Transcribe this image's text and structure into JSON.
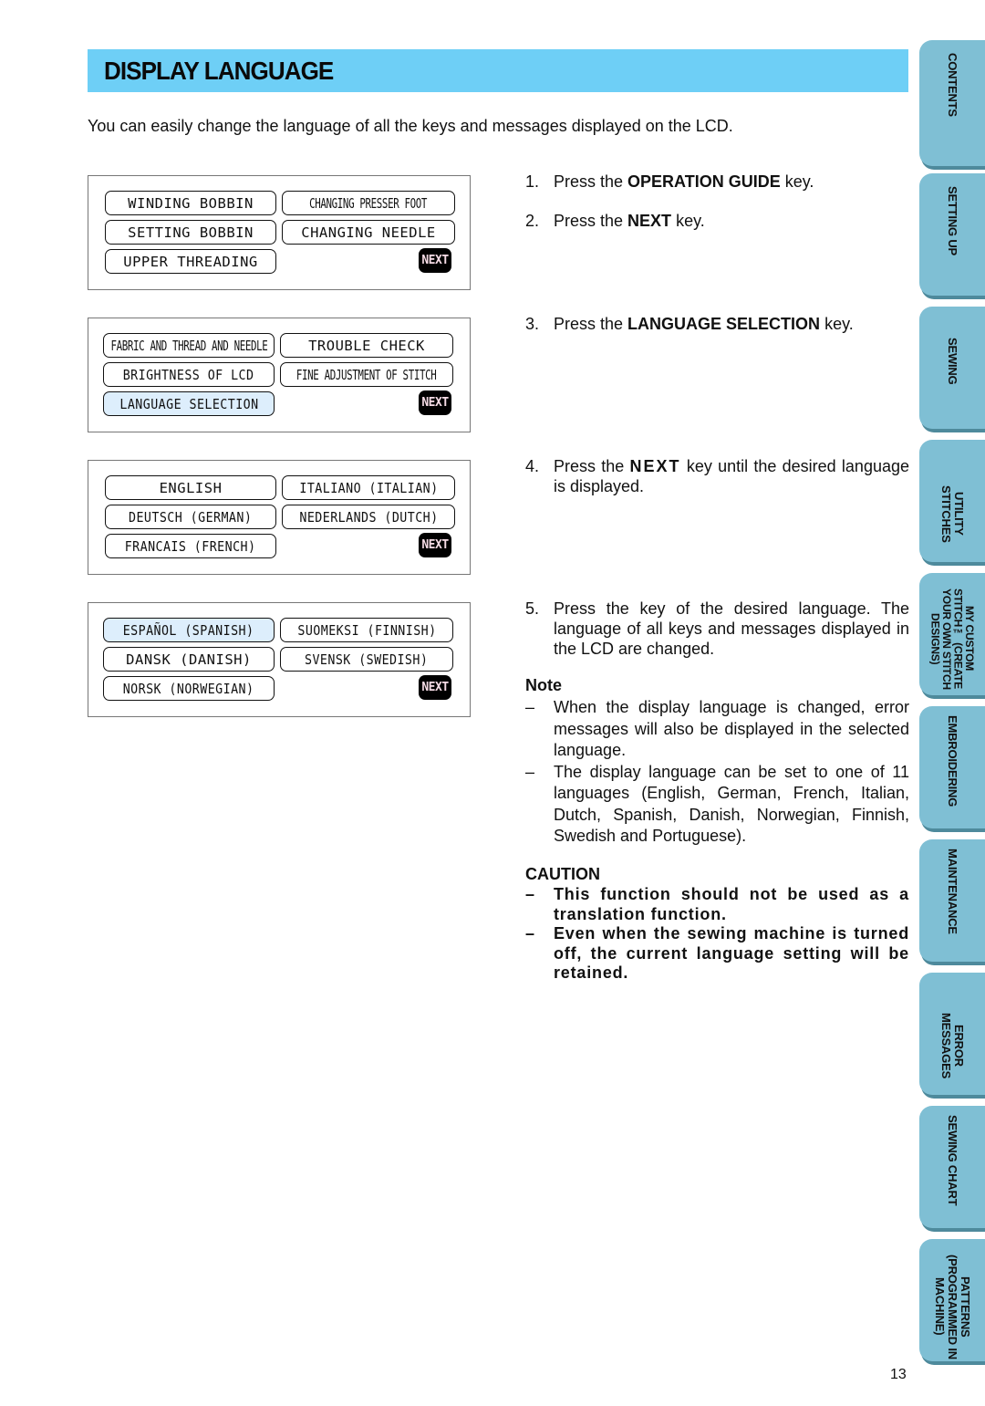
{
  "header": {
    "title": "DISPLAY LANGUAGE",
    "accent_color": "#6ecff6"
  },
  "intro": "You can easily change the language of all the keys and messages displayed on the LCD.",
  "lcd_screens": [
    {
      "keys": [
        "WINDING BOBBIN",
        "CHANGING PRESSER FOOT",
        "SETTING BOBBIN",
        "CHANGING NEEDLE",
        "UPPER THREADING"
      ],
      "next": "NEXT"
    },
    {
      "keys": [
        "FABRIC AND THREAD AND NEEDLE",
        "TROUBLE CHECK",
        "BRIGHTNESS OF LCD",
        "FINE ADJUSTMENT OF STITCH",
        "LANGUAGE SELECTION"
      ],
      "selected": "LANGUAGE SELECTION",
      "next": "NEXT"
    },
    {
      "keys": [
        "ENGLISH",
        "ITALIANO (ITALIAN)",
        "DEUTSCH (GERMAN)",
        "NEDERLANDS (DUTCH)",
        "FRANCAIS (FRENCH)"
      ],
      "next": "NEXT"
    },
    {
      "keys": [
        "ESPAÑOL (SPANISH)",
        "SUOMEKSI (FINNISH)",
        "DANSK (DANISH)",
        "SVENSK (SWEDISH)",
        "NORSK (NORWEGIAN)"
      ],
      "selected": "ESPAÑOL (SPANISH)",
      "next": "NEXT"
    }
  ],
  "steps": [
    {
      "num": "1.",
      "pre": "Press the ",
      "bold": "OPERATION GUIDE",
      "post": " key."
    },
    {
      "num": "2.",
      "pre": "Press the ",
      "bold": "NEXT",
      "post": " key."
    },
    {
      "num": "3.",
      "pre": "Press the ",
      "bold": "LANGUAGE SELECTION",
      "post": " key."
    },
    {
      "num": "4.",
      "pre": "Press the ",
      "bold": "NEXT",
      "post": " key until the desired language is displayed."
    },
    {
      "num": "5.",
      "pre": "Press the key of the desired language. The language of all keys and messages displayed in the LCD are changed.",
      "bold": "",
      "post": ""
    }
  ],
  "note": {
    "heading": "Note",
    "dash": "–",
    "items": [
      "When the display language is changed, error messages will also be displayed in the selected language.",
      "The display language can be set to one of 11 languages (English, German, French, Italian, Dutch, Spanish, Danish, Norwegian, Finnish, Swedish and Portuguese)."
    ]
  },
  "caution": {
    "heading": "CAUTION",
    "dash": "–",
    "items": [
      "This function should not be used as a translation function.",
      "Even when the sewing machine is turned off, the current language setting will be retained."
    ]
  },
  "side_tabs": [
    {
      "label": "CONTENTS"
    },
    {
      "label": "SETTING UP"
    },
    {
      "label": "SEWING"
    },
    {
      "label": "UTILITY STITCHES"
    },
    {
      "label": "MY CUSTOM STITCH™ (CREATE YOUR OWN STITCH DESIGNS)"
    },
    {
      "label": "EMBROIDERING"
    },
    {
      "label": "MAINTENANCE"
    },
    {
      "label": "ERROR MESSAGES"
    },
    {
      "label": "SEWING CHART"
    },
    {
      "label": "PATTERNS (PROGRAMMED IN MACHINE)"
    }
  ],
  "tab_color": "#7fbfd4",
  "page_number": "13"
}
